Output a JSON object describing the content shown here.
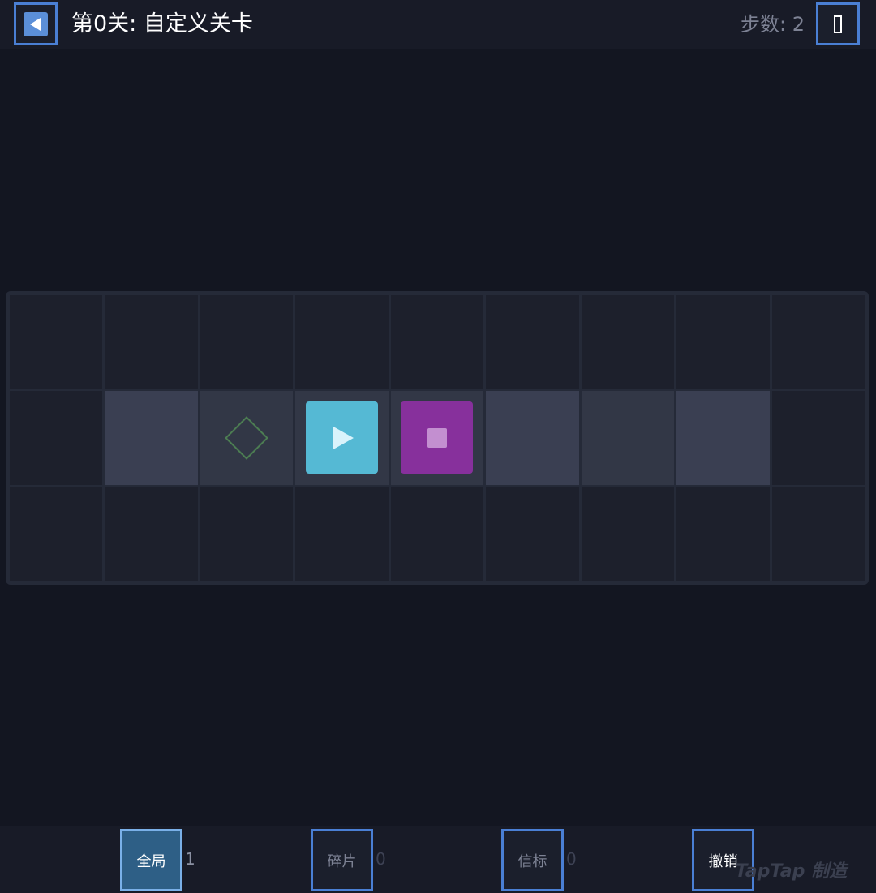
{
  "header": {
    "level_title": "第0关: 自定义关卡",
    "steps_label": "步数: 2",
    "back_icon": "back-arrow-icon",
    "menu_icon": "menu-icon"
  },
  "board": {
    "rows": 3,
    "cols": 9,
    "floor_row": 2,
    "floor_cols": [
      2,
      3,
      4,
      5,
      6,
      7,
      8
    ],
    "goal": {
      "row": 2,
      "col": 3,
      "icon": "diamond-goal-icon"
    },
    "player": {
      "row": 2,
      "col": 4,
      "icon": "play-arrow-icon"
    },
    "box": {
      "row": 2,
      "col": 5,
      "icon": "box-icon"
    },
    "colors": {
      "player": "#55b9d4",
      "box": "#87309c",
      "goal": "#4c7d52",
      "floor": "#3a3f52",
      "wall": "#1d202c"
    }
  },
  "toolbar": {
    "global_label": "全局",
    "global_count": "1",
    "fragment_label": "碎片",
    "fragment_count": "0",
    "beacon_label": "信标",
    "beacon_count": "0",
    "undo_label": "撤销"
  },
  "watermark": "TapTap 制造"
}
